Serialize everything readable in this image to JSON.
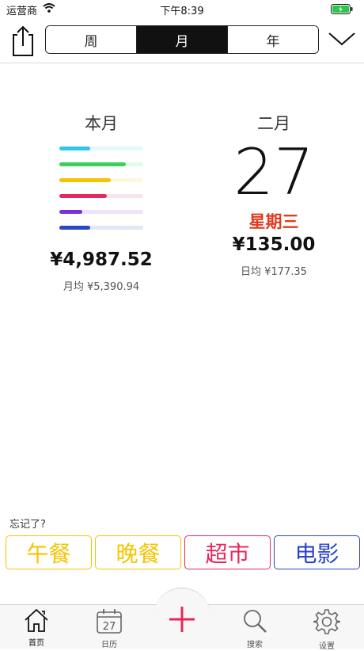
{
  "status": {
    "carrier": "运营商",
    "time": "下午8:39"
  },
  "segments": [
    {
      "label": "周",
      "active": false
    },
    {
      "label": "月",
      "active": true
    },
    {
      "label": "年",
      "active": false
    }
  ],
  "month_summary": {
    "title": "本月",
    "total": "¥4,987.52",
    "average": "月均 ¥5,390.94",
    "category_bars": [
      {
        "color": "#2fc6e8",
        "fraction": 0.37
      },
      {
        "color": "#3ccf5a",
        "fraction": 0.79
      },
      {
        "color": "#f5c400",
        "fraction": 0.61
      },
      {
        "color": "#e8275a",
        "fraction": 0.57
      },
      {
        "color": "#7a30d8",
        "fraction": 0.27
      },
      {
        "color": "#2b44c8",
        "fraction": 0.37
      }
    ]
  },
  "day_summary": {
    "month": "二月",
    "day": "27",
    "weekday": "星期三",
    "total": "¥135.00",
    "average": "日均 ¥177.35"
  },
  "forgot_label": "忘记了?",
  "quick_buttons": [
    {
      "label": "午餐",
      "color": "#f5c400"
    },
    {
      "label": "晚餐",
      "color": "#f5c400"
    },
    {
      "label": "超市",
      "color": "#e8275a"
    },
    {
      "label": "电影",
      "color": "#2b44c8"
    }
  ],
  "tabbar": {
    "home": "首页",
    "calendar": "日历",
    "calendar_day": "27",
    "search": "搜索",
    "settings": "设置"
  },
  "accent_color": "#e8275a"
}
